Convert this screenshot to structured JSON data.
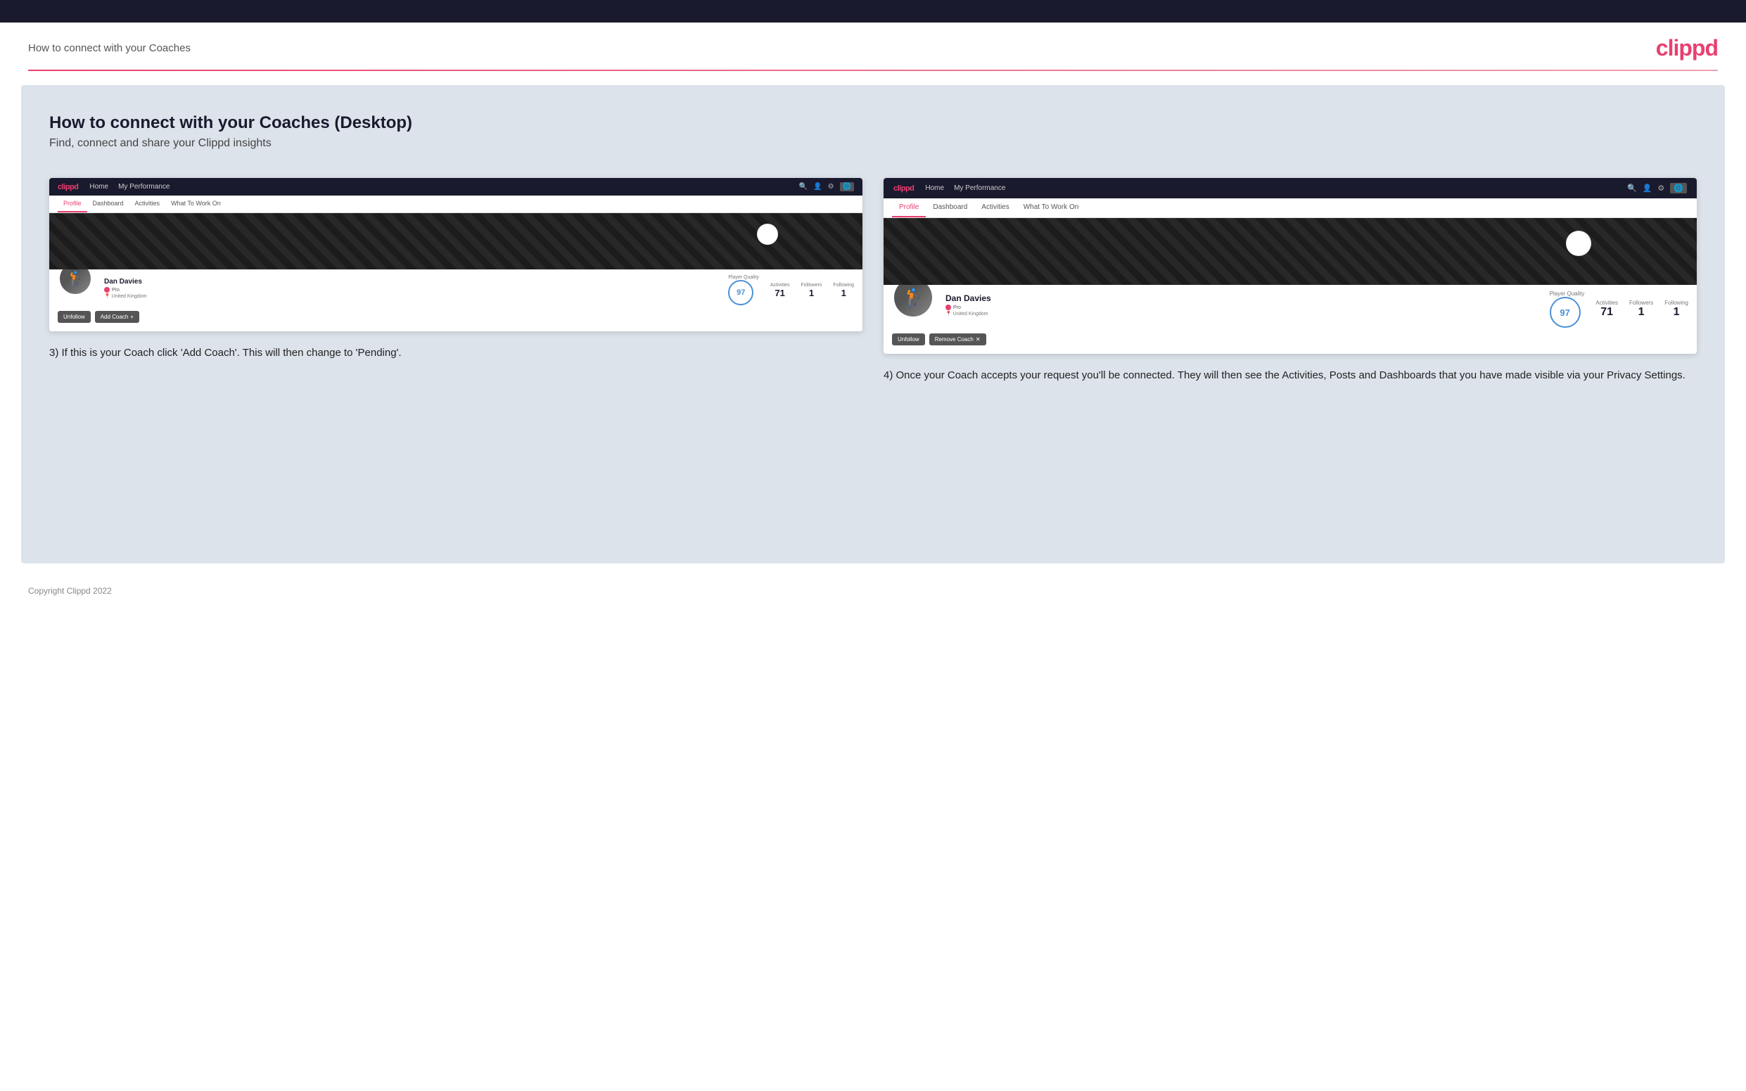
{
  "topbar": {},
  "header": {
    "title": "How to connect with your Coaches",
    "logo": "clippd"
  },
  "main": {
    "heading": "How to connect with your Coaches (Desktop)",
    "subheading": "Find, connect and share your Clippd insights",
    "left_screenshot": {
      "navbar": {
        "logo": "clippd",
        "links": [
          "Home",
          "My Performance"
        ],
        "tabs": [
          "Profile",
          "Dashboard",
          "Activities",
          "What To Work On"
        ]
      },
      "profile": {
        "name": "Dan Davies",
        "badge": "Pro",
        "location": "United Kingdom",
        "quality_label": "Player Quality",
        "quality_value": "97",
        "activities_label": "Activities",
        "activities_value": "71",
        "followers_label": "Followers",
        "followers_value": "1",
        "following_label": "Following",
        "following_value": "1"
      },
      "buttons": {
        "unfollow": "Unfollow",
        "add_coach": "Add Coach"
      }
    },
    "right_screenshot": {
      "navbar": {
        "logo": "clippd",
        "links": [
          "Home",
          "My Performance"
        ],
        "tabs": [
          "Profile",
          "Dashboard",
          "Activities",
          "What To Work On"
        ]
      },
      "profile": {
        "name": "Dan Davies",
        "badge": "Pro",
        "location": "United Kingdom",
        "quality_label": "Player Quality",
        "quality_value": "97",
        "activities_label": "Activities",
        "activities_value": "71",
        "followers_label": "Followers",
        "followers_value": "1",
        "following_label": "Following",
        "following_value": "1"
      },
      "buttons": {
        "unfollow": "Unfollow",
        "remove_coach": "Remove Coach"
      }
    },
    "left_caption": "3) If this is your Coach click 'Add Coach'. This will then change to 'Pending'.",
    "right_caption": "4) Once your Coach accepts your request you'll be connected. They will then see the Activities, Posts and Dashboards that you have made visible via your Privacy Settings."
  },
  "footer": {
    "text": "Copyright Clippd 2022"
  }
}
